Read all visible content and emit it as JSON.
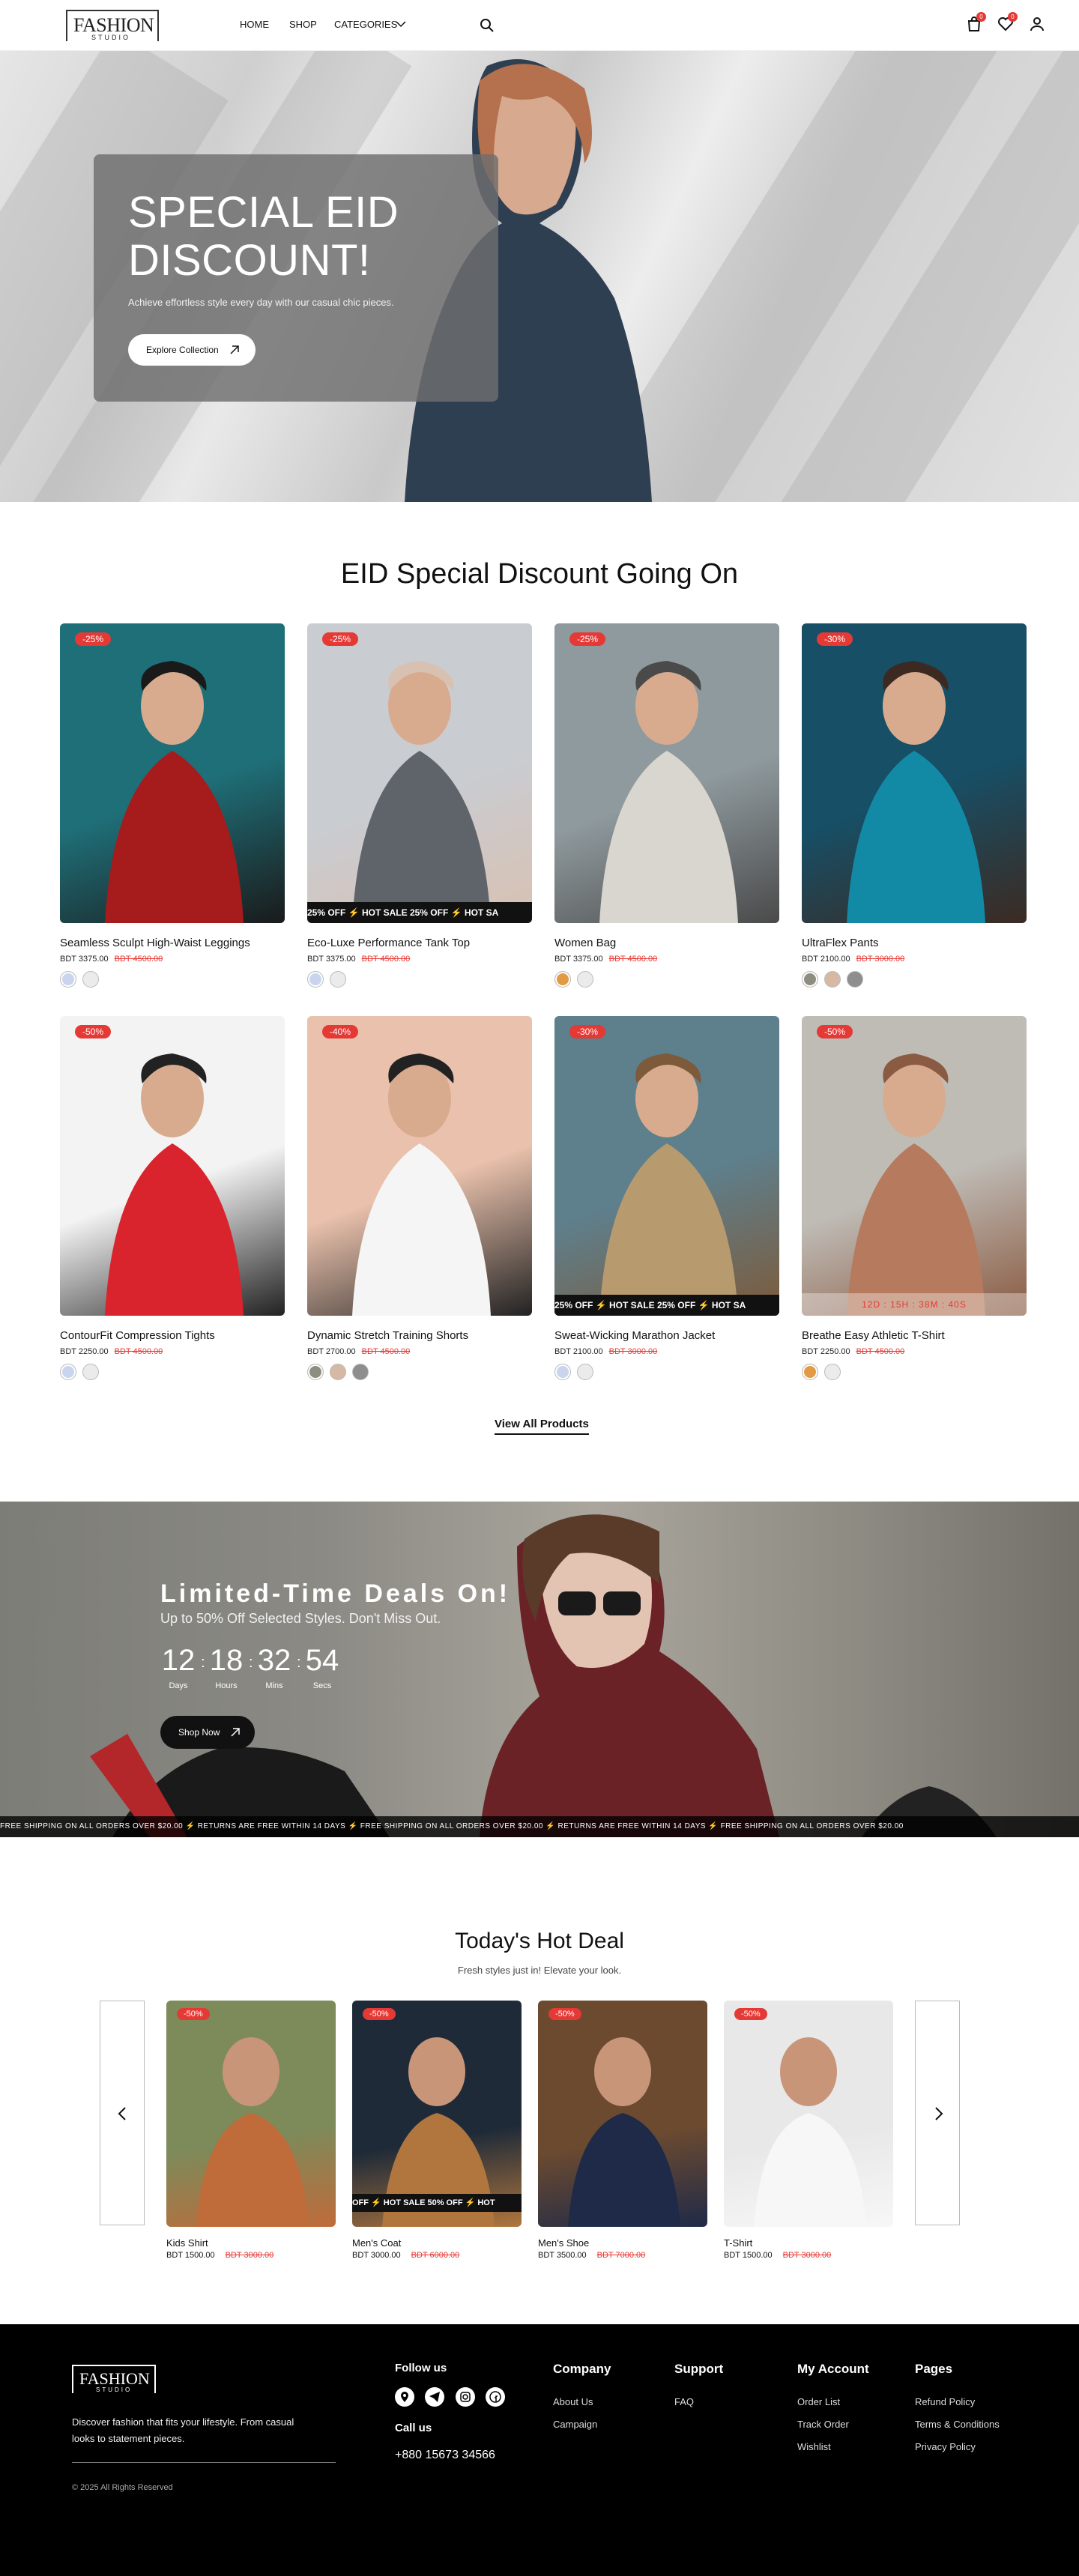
{
  "header": {
    "logo_main": "FASHION",
    "logo_sub": "STUDIO",
    "nav": [
      "HOME",
      "SHOP",
      "CATEGORIES"
    ],
    "cart_count": "0",
    "wishlist_count": "0"
  },
  "hero": {
    "title_line1": "SPECIAL EID",
    "title_line2": "DISCOUNT!",
    "subtitle": "Achieve effortless style every day with our casual chic pieces.",
    "button": "Explore Collection"
  },
  "eid_section": {
    "title": "EID Special Discount Going On",
    "products": [
      {
        "name": "Seamless Sculpt High-Waist Leggings",
        "price": "BDT 3375.00",
        "old": "BDT 4500.00",
        "discount": "-25%",
        "colors": [
          "#c9d4ee",
          "#ebebeb"
        ]
      },
      {
        "name": "Eco-Luxe Performance Tank Top",
        "price": "BDT 3375.00",
        "old": "BDT 4500.00",
        "discount": "-25%",
        "colors": [
          "#c9d4ee",
          "#ebebeb"
        ],
        "banner": "25% OFF  ⚡  HOT SALE 25% OFF  ⚡  HOT SA"
      },
      {
        "name": "Women Bag",
        "price": "BDT 3375.00",
        "old": "BDT 4500.00",
        "discount": "-25%",
        "colors": [
          "#e29a45",
          "#ebebeb"
        ]
      },
      {
        "name": "UltraFlex Pants",
        "price": "BDT 2100.00",
        "old": "BDT 3000.00",
        "discount": "-30%",
        "colors": [
          "#8e8e80",
          "#d6b9a5",
          "#8e8e8e"
        ]
      },
      {
        "name": "ContourFit Compression Tights",
        "price": "BDT 2250.00",
        "old": "BDT 4500.00",
        "discount": "-50%",
        "colors": [
          "#c9d4ee",
          "#ebebeb"
        ]
      },
      {
        "name": "Dynamic Stretch Training Shorts",
        "price": "BDT 2700.00",
        "old": "BDT 4500.00",
        "discount": "-40%",
        "colors": [
          "#8e8e80",
          "#d6b9a5",
          "#8e8e8e"
        ]
      },
      {
        "name": "Sweat-Wicking Marathon Jacket",
        "price": "BDT 2100.00",
        "old": "BDT 3000.00",
        "discount": "-30%",
        "colors": [
          "#c9d4ee",
          "#ebebeb"
        ],
        "banner": "25% OFF  ⚡  HOT SALE 25% OFF  ⚡  HOT SA"
      },
      {
        "name": "Breathe Easy Athletic T-Shirt",
        "price": "BDT 2250.00",
        "old": "BDT 4500.00",
        "discount": "-50%",
        "colors": [
          "#e29a45",
          "#ebebeb"
        ],
        "timer": "12D : 15H : 38M : 40S"
      }
    ],
    "view_all": "View All Products"
  },
  "deals": {
    "title": "Limited-Time Deals On!",
    "subtitle": "Up to 50% Off Selected Styles. Don't Miss Out.",
    "countdown": [
      {
        "value": "12",
        "label": "Days"
      },
      {
        "value": "18",
        "label": "Hours"
      },
      {
        "value": "32",
        "label": "Mins"
      },
      {
        "value": "54",
        "label": "Secs"
      }
    ],
    "button": "Shop Now",
    "ticker": "FREE SHIPPING ON ALL ORDERS OVER $20.00    ⚡    RETURNS ARE FREE WITHIN 14 DAYS    ⚡    FREE SHIPPING ON ALL ORDERS OVER $20.00    ⚡    RETURNS ARE FREE WITHIN 14 DAYS    ⚡    FREE SHIPPING ON ALL ORDERS OVER $20.00"
  },
  "hot_deal": {
    "title": "Today's Hot Deal",
    "subtitle": "Fresh styles just in! Elevate your look.",
    "products": [
      {
        "name": "Kids Shirt",
        "price": "BDT 1500.00",
        "old": "BDT 3000.00",
        "discount": "-50%"
      },
      {
        "name": "Men's Coat",
        "price": "BDT 3000.00",
        "old": "BDT 6000.00",
        "discount": "-50%",
        "banner": "OFF  ⚡  HOT SALE 50% OFF  ⚡  HOT"
      },
      {
        "name": "Men's Shoe",
        "price": "BDT 3500.00",
        "old": "BDT 7000.00",
        "discount": "-50%"
      },
      {
        "name": "T-Shirt",
        "price": "BDT 1500.00",
        "old": "BDT 3000.00",
        "discount": "-50%"
      }
    ]
  },
  "footer": {
    "tagline": "Discover fashion that fits your lifestyle. From casual looks to statement pieces.",
    "copyright": "© 2025 All Rights Reserved",
    "follow": "Follow us",
    "call": "Call us",
    "phone": "+880 15673 34566",
    "company": {
      "title": "Company",
      "links": [
        "About Us",
        "Campaign"
      ]
    },
    "support": {
      "title": "Support",
      "links": [
        "FAQ"
      ]
    },
    "account": {
      "title": "My Account",
      "links": [
        "Order List",
        "Track Order",
        "Wishlist"
      ]
    },
    "pages": {
      "title": "Pages",
      "links": [
        "Refund Policy",
        "Terms & Conditions",
        "Privacy Policy"
      ]
    }
  }
}
